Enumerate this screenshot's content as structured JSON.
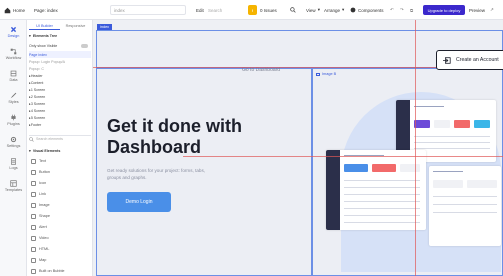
{
  "topbar": {
    "home_label": "Home",
    "page_label": "Page: index",
    "page_name": "index",
    "edit_label": "Edit",
    "search_placeholder": "Search",
    "issues_label": "0 Issues",
    "view_label": "View",
    "arrange_label": "Arrange",
    "components_label": "Components",
    "upgrade_label": "Upgrade to deploy",
    "preview_label": "Preview",
    "colors": {
      "accent": "#3b5bdb",
      "upgrade_bg": "#3b28cc",
      "issues_bg": "#f5b400"
    }
  },
  "leftnav": {
    "items": [
      {
        "label": "Design",
        "icon": "close-x-icon"
      },
      {
        "label": "Workflow",
        "icon": "workflow-icon"
      },
      {
        "label": "Data",
        "icon": "database-icon"
      },
      {
        "label": "Styles",
        "icon": "brush-icon"
      },
      {
        "label": "Plugins",
        "icon": "plug-icon"
      },
      {
        "label": "Settings",
        "icon": "gear-icon"
      },
      {
        "label": "Logs",
        "icon": "log-icon"
      },
      {
        "label": "Templates",
        "icon": "template-icon"
      }
    ]
  },
  "panel": {
    "tabs": [
      "UI Builder",
      "Responsive"
    ],
    "elements_tree_title": "Elements Tree",
    "show_visible_label": "Only show Visible",
    "tree": [
      "Page index",
      "Popup: Login Popup/A",
      "Popup: C",
      "Header",
      "Content",
      "1 Screen",
      "2 Screen",
      "3 Screen",
      "4 Screen",
      "5 Screen",
      "Footer"
    ],
    "search_placeholder": "Search elements",
    "visual_elements_title": "Visual Elements",
    "visual_elements": [
      "Text",
      "Button",
      "Icon",
      "Link",
      "Image",
      "Shape",
      "Alert",
      "Video",
      "HTML",
      "Map",
      "Built on Bubble"
    ]
  },
  "canvas": {
    "page_tag": "index",
    "goto_label": "Go to Dashboard",
    "image_tag": "Image B",
    "headline": "Get it done with Dashboard",
    "subtext": "Get ready solutions for your project: forms, tabs, groups and graphs.",
    "demo_button": "Demo Login",
    "cta_label": "Create an Account"
  }
}
